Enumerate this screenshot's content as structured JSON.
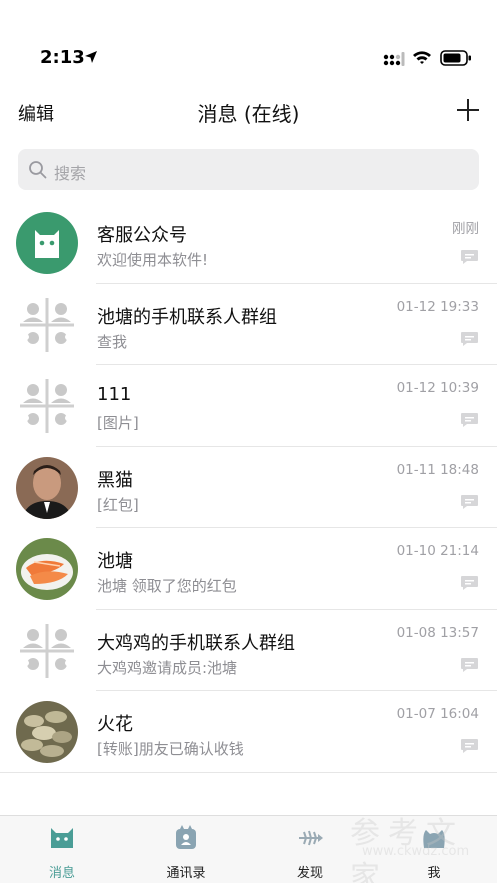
{
  "status": {
    "time": "2:13"
  },
  "nav": {
    "edit": "编辑",
    "title": "消息 (在线)"
  },
  "search": {
    "placeholder": "搜索"
  },
  "conversations": [
    {
      "name": "客服公众号",
      "preview": "欢迎使用本软件!",
      "time": "刚刚",
      "avatar": "cat-logo-avatar"
    },
    {
      "name": "池塘的手机联系人群组",
      "preview": "查我",
      "time": "01-12 19:33",
      "avatar": "group-avatar"
    },
    {
      "name": "111",
      "preview": "[图片]",
      "time": "01-12 10:39",
      "avatar": "group-avatar"
    },
    {
      "name": "黑猫",
      "preview": "[红包]",
      "time": "01-11 18:48",
      "avatar": "person-photo-avatar"
    },
    {
      "name": "池塘",
      "preview": "池塘 领取了您的红包",
      "time": "01-10 21:14",
      "avatar": "food-photo-avatar"
    },
    {
      "name": "大鸡鸡的手机联系人群组",
      "preview": "大鸡鸡邀请成员:池塘",
      "time": "01-08 13:57",
      "avatar": "group-avatar"
    },
    {
      "name": "火花",
      "preview": "[转账]朋友已确认收钱",
      "time": "01-07 16:04",
      "avatar": "coins-photo-avatar"
    }
  ],
  "tabs": [
    {
      "label": "消息",
      "icon": "cat-chat-icon",
      "active": true
    },
    {
      "label": "通讯录",
      "icon": "contacts-book-icon",
      "active": false
    },
    {
      "label": "发现",
      "icon": "fishbone-icon",
      "active": false
    },
    {
      "label": "我",
      "icon": "cat-face-icon",
      "active": false
    }
  ],
  "watermark": {
    "text": "参考文家",
    "url": "www.ckwdz.com"
  },
  "colors": {
    "accent": "#4a9d96",
    "brand_green": "#3a9a6e",
    "divider": "#e6e6e6"
  }
}
